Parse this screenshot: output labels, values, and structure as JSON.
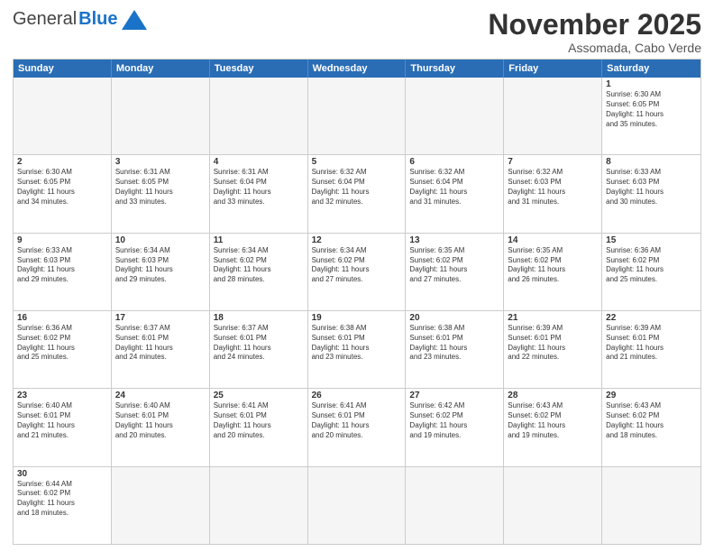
{
  "header": {
    "logo_general": "General",
    "logo_blue": "Blue",
    "month_title": "November 2025",
    "location": "Assomada, Cabo Verde"
  },
  "days_of_week": [
    "Sunday",
    "Monday",
    "Tuesday",
    "Wednesday",
    "Thursday",
    "Friday",
    "Saturday"
  ],
  "weeks": [
    [
      {
        "day": "",
        "info": ""
      },
      {
        "day": "",
        "info": ""
      },
      {
        "day": "",
        "info": ""
      },
      {
        "day": "",
        "info": ""
      },
      {
        "day": "",
        "info": ""
      },
      {
        "day": "",
        "info": ""
      },
      {
        "day": "1",
        "info": "Sunrise: 6:30 AM\nSunset: 6:05 PM\nDaylight: 11 hours\nand 35 minutes."
      }
    ],
    [
      {
        "day": "2",
        "info": "Sunrise: 6:30 AM\nSunset: 6:05 PM\nDaylight: 11 hours\nand 34 minutes."
      },
      {
        "day": "3",
        "info": "Sunrise: 6:31 AM\nSunset: 6:05 PM\nDaylight: 11 hours\nand 33 minutes."
      },
      {
        "day": "4",
        "info": "Sunrise: 6:31 AM\nSunset: 6:04 PM\nDaylight: 11 hours\nand 33 minutes."
      },
      {
        "day": "5",
        "info": "Sunrise: 6:32 AM\nSunset: 6:04 PM\nDaylight: 11 hours\nand 32 minutes."
      },
      {
        "day": "6",
        "info": "Sunrise: 6:32 AM\nSunset: 6:04 PM\nDaylight: 11 hours\nand 31 minutes."
      },
      {
        "day": "7",
        "info": "Sunrise: 6:32 AM\nSunset: 6:03 PM\nDaylight: 11 hours\nand 31 minutes."
      },
      {
        "day": "8",
        "info": "Sunrise: 6:33 AM\nSunset: 6:03 PM\nDaylight: 11 hours\nand 30 minutes."
      }
    ],
    [
      {
        "day": "9",
        "info": "Sunrise: 6:33 AM\nSunset: 6:03 PM\nDaylight: 11 hours\nand 29 minutes."
      },
      {
        "day": "10",
        "info": "Sunrise: 6:34 AM\nSunset: 6:03 PM\nDaylight: 11 hours\nand 29 minutes."
      },
      {
        "day": "11",
        "info": "Sunrise: 6:34 AM\nSunset: 6:02 PM\nDaylight: 11 hours\nand 28 minutes."
      },
      {
        "day": "12",
        "info": "Sunrise: 6:34 AM\nSunset: 6:02 PM\nDaylight: 11 hours\nand 27 minutes."
      },
      {
        "day": "13",
        "info": "Sunrise: 6:35 AM\nSunset: 6:02 PM\nDaylight: 11 hours\nand 27 minutes."
      },
      {
        "day": "14",
        "info": "Sunrise: 6:35 AM\nSunset: 6:02 PM\nDaylight: 11 hours\nand 26 minutes."
      },
      {
        "day": "15",
        "info": "Sunrise: 6:36 AM\nSunset: 6:02 PM\nDaylight: 11 hours\nand 25 minutes."
      }
    ],
    [
      {
        "day": "16",
        "info": "Sunrise: 6:36 AM\nSunset: 6:02 PM\nDaylight: 11 hours\nand 25 minutes."
      },
      {
        "day": "17",
        "info": "Sunrise: 6:37 AM\nSunset: 6:01 PM\nDaylight: 11 hours\nand 24 minutes."
      },
      {
        "day": "18",
        "info": "Sunrise: 6:37 AM\nSunset: 6:01 PM\nDaylight: 11 hours\nand 24 minutes."
      },
      {
        "day": "19",
        "info": "Sunrise: 6:38 AM\nSunset: 6:01 PM\nDaylight: 11 hours\nand 23 minutes."
      },
      {
        "day": "20",
        "info": "Sunrise: 6:38 AM\nSunset: 6:01 PM\nDaylight: 11 hours\nand 23 minutes."
      },
      {
        "day": "21",
        "info": "Sunrise: 6:39 AM\nSunset: 6:01 PM\nDaylight: 11 hours\nand 22 minutes."
      },
      {
        "day": "22",
        "info": "Sunrise: 6:39 AM\nSunset: 6:01 PM\nDaylight: 11 hours\nand 21 minutes."
      }
    ],
    [
      {
        "day": "23",
        "info": "Sunrise: 6:40 AM\nSunset: 6:01 PM\nDaylight: 11 hours\nand 21 minutes."
      },
      {
        "day": "24",
        "info": "Sunrise: 6:40 AM\nSunset: 6:01 PM\nDaylight: 11 hours\nand 20 minutes."
      },
      {
        "day": "25",
        "info": "Sunrise: 6:41 AM\nSunset: 6:01 PM\nDaylight: 11 hours\nand 20 minutes."
      },
      {
        "day": "26",
        "info": "Sunrise: 6:41 AM\nSunset: 6:01 PM\nDaylight: 11 hours\nand 20 minutes."
      },
      {
        "day": "27",
        "info": "Sunrise: 6:42 AM\nSunset: 6:02 PM\nDaylight: 11 hours\nand 19 minutes."
      },
      {
        "day": "28",
        "info": "Sunrise: 6:43 AM\nSunset: 6:02 PM\nDaylight: 11 hours\nand 19 minutes."
      },
      {
        "day": "29",
        "info": "Sunrise: 6:43 AM\nSunset: 6:02 PM\nDaylight: 11 hours\nand 18 minutes."
      }
    ],
    [
      {
        "day": "30",
        "info": "Sunrise: 6:44 AM\nSunset: 6:02 PM\nDaylight: 11 hours\nand 18 minutes."
      },
      {
        "day": "",
        "info": ""
      },
      {
        "day": "",
        "info": ""
      },
      {
        "day": "",
        "info": ""
      },
      {
        "day": "",
        "info": ""
      },
      {
        "day": "",
        "info": ""
      },
      {
        "day": "",
        "info": ""
      }
    ]
  ]
}
